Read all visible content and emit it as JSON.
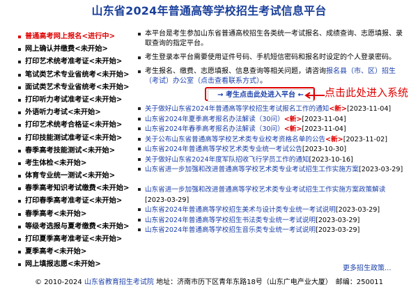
{
  "title": "山东省2024年普通高等学校招生考试信息平台",
  "sidebar": {
    "items": [
      {
        "label": "普通高考网上报名<进行中>",
        "active": true
      },
      {
        "label": "网上确认并缴费<未开始>"
      },
      {
        "label": "打印艺术统考准考证<未开始>"
      },
      {
        "label": "笔试类艺术专业省统考<未开始>"
      },
      {
        "label": "面试类艺术专业省统考<未开始>"
      },
      {
        "label": "打印听力考试准考证<未开始>"
      },
      {
        "label": "外语听力考试<未开始>"
      },
      {
        "label": "打印艺术统考合格证<未开始>"
      },
      {
        "label": "打印技能测试准考证<未开始>"
      },
      {
        "label": "春季高考技能测试<未开始>"
      },
      {
        "label": "考生体检<未开始>"
      },
      {
        "label": "体育专业统一测试<未开始>"
      },
      {
        "label": "春季高考知识考试缴费<未开始>"
      },
      {
        "label": "打印春季高考准考证<未开始>"
      },
      {
        "label": "春季高考<未开始>"
      },
      {
        "label": "等级考选报与夏考缴费<未开始>"
      },
      {
        "label": "打印夏季高考准考证<未开始>"
      },
      {
        "label": "夏季高考<未开始>"
      },
      {
        "label": "网上填报志愿<未开始>"
      }
    ]
  },
  "info": {
    "item1": "本平台是考生参加山东省普通高校招生各类统一考试报名、成绩查询、志愿填报、录取查询的指定平台。",
    "item2": "考生登录本平台需要使用证件号码、手机短信密码和报名时设定的个人登录密码。",
    "item3_prefix": "考生报名、缴费、志愿填报、信息查询等相关问题，请咨询",
    "item3_link": "报名县（市、区）招生（考试）办公室（点击查看联系方式）",
    "item3_suffix": "。"
  },
  "enter_button": "→ 考生点击此处进入平台 ←",
  "annotation": "点击此处进入系统",
  "notices": [
    {
      "title": "关于做好山东省2024年普通高等学校招生考试报名工作的通知",
      "new": "<新>",
      "date": "[2023-11-04]"
    },
    {
      "title": "山东省2024年夏季高考报名办法解读（30问）",
      "new": "<新>",
      "date": "[2023-11-04]"
    },
    {
      "title": "山东省2024年春季高考报名办法解读（30问）",
      "new": "<新>",
      "date": "[2023-11-04]"
    },
    {
      "title": "关于公布山东省普通高等学校艺术类专业校考资格名单的公告",
      "new": "<新>",
      "date": "[2023-11-02]"
    },
    {
      "title": "山东省2024年普通高等学校艺术类专业统一考试公告",
      "new": "",
      "date": "[2023-10-30]"
    },
    {
      "title": "关于做好山东省2024年度军队招收飞行学员工作的通知",
      "new": "",
      "date": "[2023-10-16]"
    },
    {
      "title": "山东省进一步加强和改进普通高等学校艺术类专业考试招生工作实施方案",
      "new": "",
      "date": "[2023-03-29]"
    },
    {
      "title": "山东省进一步加强和改进普通高等学校艺术类专业考试招生工作实施方案政策解读",
      "new": "",
      "date": "[2023-03-29]"
    },
    {
      "title": "山东省2024年普通高等学校招生美术与设计类专业统一考试说明",
      "new": "",
      "date": "[2023-03-29]"
    },
    {
      "title": "山东省2024年普通高等学校招生书法类专业统一考试说明",
      "new": "",
      "date": "[2023-03-29]"
    },
    {
      "title": "山东省2024年普通高等学校招生音乐类专业统一考试说明",
      "new": "",
      "date": "[2023-03-29]"
    }
  ],
  "more_link": "更多招生政策...",
  "footer": {
    "copyright": "© 2010-2024",
    "org_link": "山东省教育招生考试院",
    "address": "地址：济南市历下区青年东路18号（山东广电产业大厦）　邮编：250011"
  },
  "colors": {
    "title": "#1a3f9a",
    "accent": "#e00000",
    "link": "#1a3faa"
  }
}
